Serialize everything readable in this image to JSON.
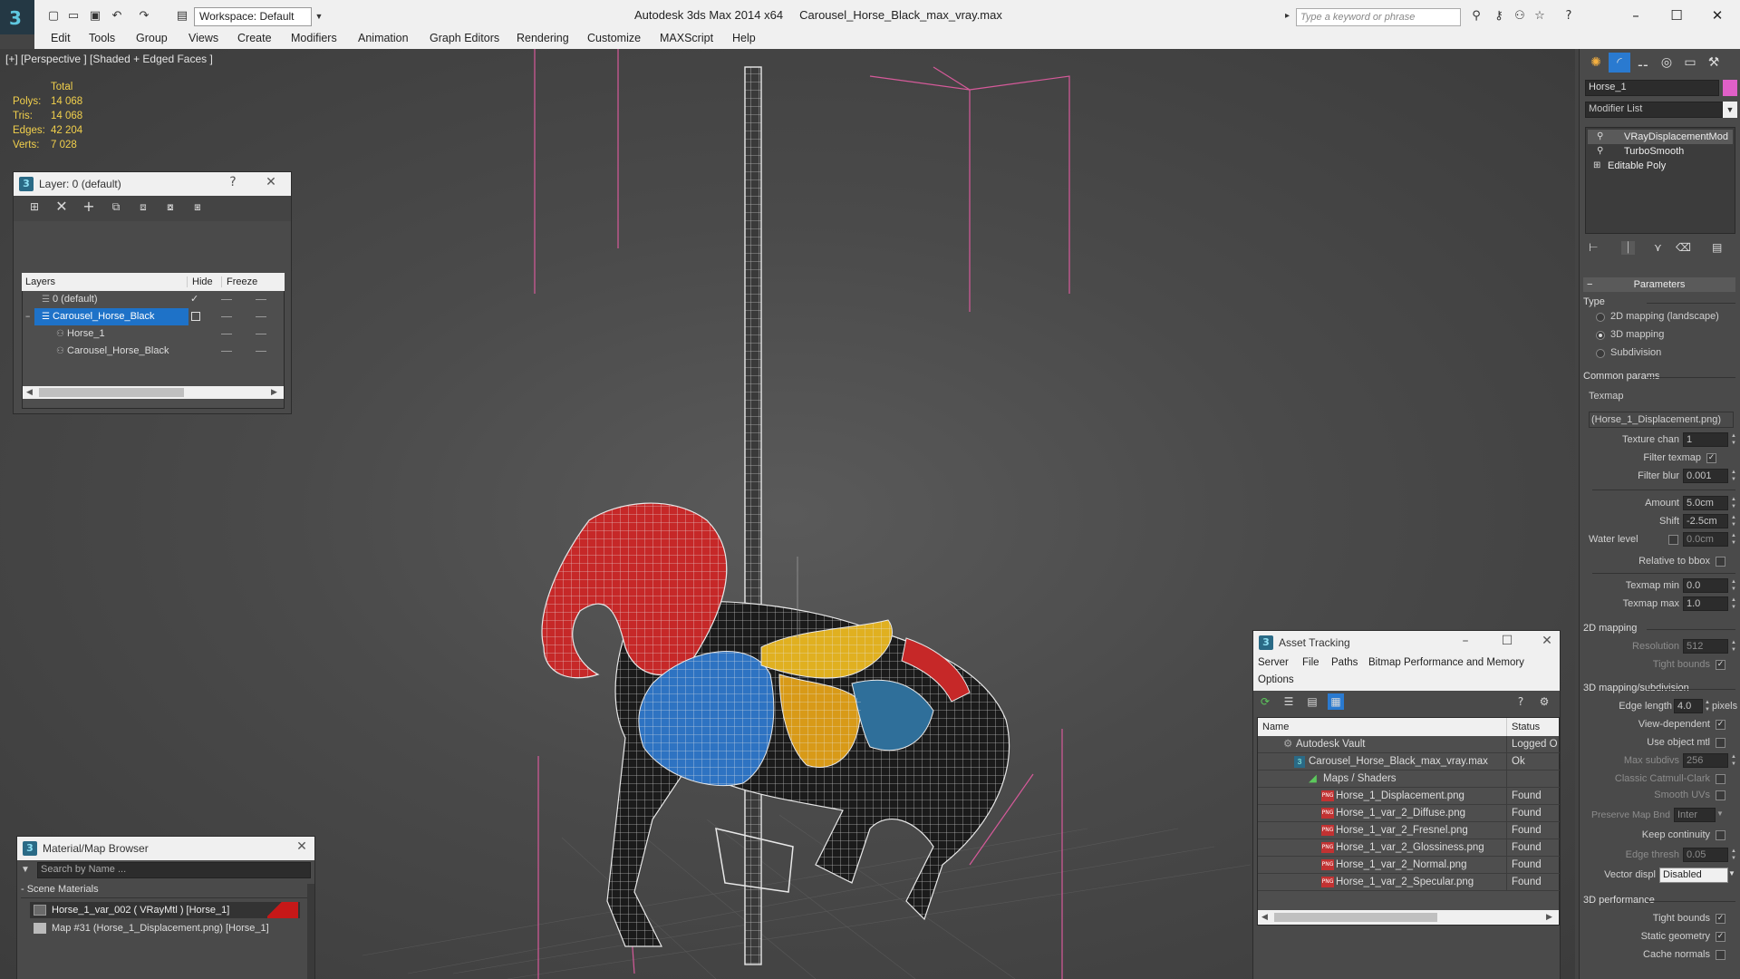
{
  "app": {
    "title": "Autodesk 3ds Max  2014 x64",
    "file": "Carousel_Horse_Black_max_vray.max",
    "workspace": "Workspace: Default",
    "search_placeholder": "Type a keyword or phrase"
  },
  "menu": [
    "Edit",
    "Tools",
    "Group",
    "Views",
    "Create",
    "Modifiers",
    "Animation",
    "Graph Editors",
    "Rendering",
    "Customize",
    "MAXScript",
    "Help"
  ],
  "viewport": {
    "label": "[+] [Perspective ] [Shaded + Edged Faces ]",
    "stats": {
      "header": "Total",
      "rows": [
        {
          "label": "Polys:",
          "value": "14 068"
        },
        {
          "label": "Tris:",
          "value": "14 068"
        },
        {
          "label": "Edges:",
          "value": "42 204"
        },
        {
          "label": "Verts:",
          "value": "7 028"
        }
      ]
    }
  },
  "layer_panel": {
    "title": "Layer: 0 (default)",
    "help": "?",
    "columns": [
      "Layers",
      "Hide",
      "Freeze"
    ],
    "rows": [
      {
        "name": "0 (default)"
      },
      {
        "name": "Carousel_Horse_Black"
      },
      {
        "name": "Horse_1"
      },
      {
        "name": "Carousel_Horse_Black"
      }
    ]
  },
  "material_browser": {
    "title": "Material/Map Browser",
    "search_placeholder": "Search by Name ...",
    "section": "- Scene Materials",
    "items": [
      "Horse_1_var_002  ( VRayMtl )  [Horse_1]",
      "Map #31 (Horse_1_Displacement.png) [Horse_1]"
    ]
  },
  "asset_tracking": {
    "title": "Asset Tracking",
    "menu": [
      "Server",
      "File",
      "Paths",
      "Bitmap Performance and Memory",
      "Options"
    ],
    "columns": [
      "Name",
      "Status"
    ],
    "rows": [
      {
        "name": "Autodesk Vault",
        "status": "Logged O"
      },
      {
        "name": "Carousel_Horse_Black_max_vray.max",
        "status": "Ok"
      },
      {
        "name": "Maps / Shaders",
        "status": ""
      },
      {
        "name": "Horse_1_Displacement.png",
        "status": "Found"
      },
      {
        "name": "Horse_1_var_2_Diffuse.png",
        "status": "Found"
      },
      {
        "name": "Horse_1_var_2_Fresnel.png",
        "status": "Found"
      },
      {
        "name": "Horse_1_var_2_Glossiness.png",
        "status": "Found"
      },
      {
        "name": "Horse_1_var_2_Normal.png",
        "status": "Found"
      },
      {
        "name": "Horse_1_var_2_Specular.png",
        "status": "Found"
      }
    ]
  },
  "command_panel": {
    "object_name": "Horse_1",
    "object_color": "#e060c8",
    "modifier_list": "Modifier List",
    "stack": [
      "VRayDisplacementMod",
      "TurboSmooth",
      "Editable Poly"
    ],
    "parameters": "Parameters",
    "type_label": "Type",
    "types": [
      "2D mapping (landscape)",
      "3D mapping",
      "Subdivision"
    ],
    "selected_type": 1,
    "common_params": "Common params",
    "texmap_label": "Texmap",
    "texmap_value": "(Horse_1_Displacement.png)",
    "texture_chan": {
      "label": "Texture chan",
      "value": "1"
    },
    "filter_texmap": "Filter texmap",
    "filter_blur": {
      "label": "Filter blur",
      "value": "0.001"
    },
    "amount": {
      "label": "Amount",
      "value": "5.0cm"
    },
    "shift": {
      "label": "Shift",
      "value": "-2.5cm"
    },
    "water_level": {
      "label": "Water level",
      "value": "0.0cm"
    },
    "relative_bbox": "Relative to bbox",
    "texmap_min": {
      "label": "Texmap min",
      "value": "0.0"
    },
    "texmap_max": {
      "label": "Texmap max",
      "value": "1.0"
    },
    "sec_2d": "2D mapping",
    "resolution": {
      "label": "Resolution",
      "value": "512"
    },
    "tight_bounds": "Tight bounds",
    "sec_3d": "3D mapping/subdivision",
    "edge_length": {
      "label": "Edge length",
      "value": "4.0",
      "unit": "pixels"
    },
    "view_dependent": "View-dependent",
    "use_object_mtl": "Use object mtl",
    "max_subdivs": {
      "label": "Max subdivs",
      "value": "256"
    },
    "classic_cc": "Classic Catmull-Clark",
    "smooth_uvs": "Smooth UVs",
    "preserve_map": {
      "label": "Preserve Map Bnd",
      "value": "Inter"
    },
    "keep_continuity": "Keep continuity",
    "edge_thresh": {
      "label": "Edge thresh",
      "value": "0.05"
    },
    "vector_displ": {
      "label": "Vector displ",
      "value": "Disabled"
    },
    "sec_perf": "3D performance",
    "tight_bounds2": "Tight bounds",
    "static_geometry": "Static geometry",
    "cache_normals": "Cache normals"
  }
}
